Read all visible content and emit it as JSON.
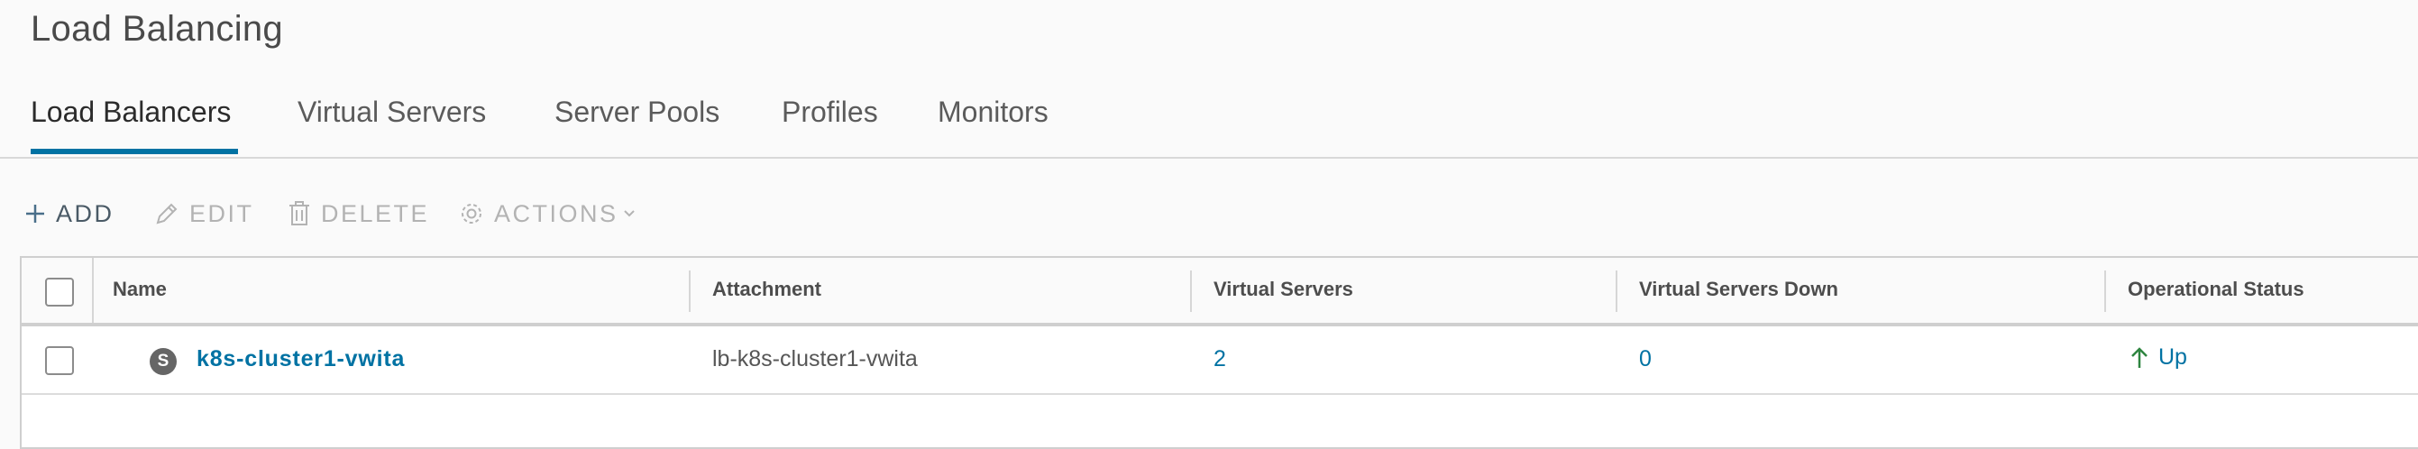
{
  "page": {
    "title": "Load Balancing"
  },
  "tabs": [
    {
      "label": "Load Balancers",
      "active": true
    },
    {
      "label": "Virtual Servers",
      "active": false
    },
    {
      "label": "Server Pools",
      "active": false
    },
    {
      "label": "Profiles",
      "active": false
    },
    {
      "label": "Monitors",
      "active": false
    }
  ],
  "toolbar": {
    "add_label": "ADD",
    "edit_label": "EDIT",
    "delete_label": "DELETE",
    "actions_label": "ACTIONS",
    "add_icon": "plus-icon",
    "edit_icon": "pencil-icon",
    "delete_icon": "trash-icon",
    "actions_icon": "gear-icon"
  },
  "table": {
    "columns": [
      "Name",
      "Attachment",
      "Virtual Servers",
      "Virtual Servers Down",
      "Operational Status"
    ],
    "rows": [
      {
        "badge": "S",
        "name": "k8s-cluster1-vwita",
        "attachment": "lb-k8s-cluster1-vwita",
        "virtual_servers": "2",
        "virtual_servers_down": "0",
        "operational_status": "Up",
        "status_icon": "arrow-up-icon"
      }
    ]
  },
  "colors": {
    "accent": "#0072a3",
    "status_up": "#2e8540",
    "disabled": "#b3b3b3"
  }
}
